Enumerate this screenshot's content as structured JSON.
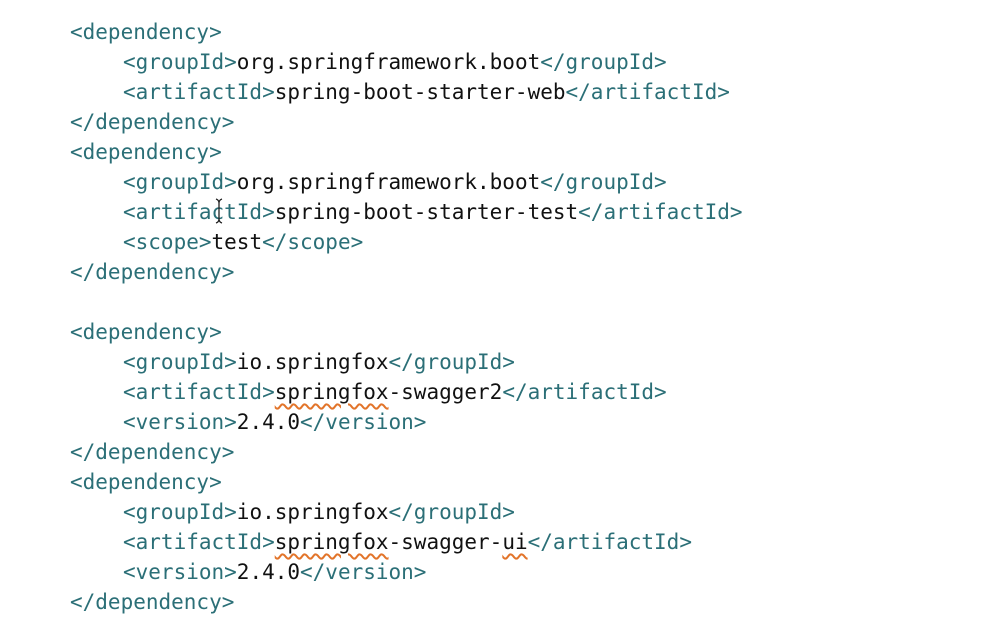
{
  "colors": {
    "tag": "#2b6f77",
    "text": "#111111",
    "spellcheck": "#e2742a",
    "background": "#ffffff"
  },
  "cursor": {
    "icon": "i-beam-cursor-icon"
  },
  "code_lines": [
    {
      "indent": 0,
      "parts": [
        {
          "t": "tag",
          "s": "<dependency>"
        }
      ]
    },
    {
      "indent": 1,
      "parts": [
        {
          "t": "tag",
          "s": "<groupId>"
        },
        {
          "t": "val",
          "s": "org.springframework.boot"
        },
        {
          "t": "tag",
          "s": "</groupId>"
        }
      ]
    },
    {
      "indent": 1,
      "parts": [
        {
          "t": "tag",
          "s": "<artifactId>"
        },
        {
          "t": "val",
          "s": "spring-boot-starter-web"
        },
        {
          "t": "tag",
          "s": "</artifactId>"
        }
      ]
    },
    {
      "indent": 0,
      "parts": [
        {
          "t": "tag",
          "s": "</dependency>"
        }
      ]
    },
    {
      "indent": 0,
      "parts": [
        {
          "t": "tag",
          "s": "<dependency>"
        }
      ]
    },
    {
      "indent": 1,
      "parts": [
        {
          "t": "tag",
          "s": "<groupId>"
        },
        {
          "t": "val",
          "s": "org.springframework.boot"
        },
        {
          "t": "tag",
          "s": "</groupId>"
        }
      ]
    },
    {
      "indent": 1,
      "parts": [
        {
          "t": "tag",
          "s": "<artifactId>"
        },
        {
          "t": "val",
          "s": "spring-boot-starter-test"
        },
        {
          "t": "tag",
          "s": "</artifactId>"
        }
      ]
    },
    {
      "indent": 1,
      "parts": [
        {
          "t": "tag",
          "s": "<scope>"
        },
        {
          "t": "val",
          "s": "test"
        },
        {
          "t": "tag",
          "s": "</scope>"
        }
      ]
    },
    {
      "indent": 0,
      "parts": [
        {
          "t": "tag",
          "s": "</dependency>"
        }
      ]
    },
    {
      "indent": 0,
      "parts": []
    },
    {
      "indent": 0,
      "parts": [
        {
          "t": "tag",
          "s": "<dependency>"
        }
      ]
    },
    {
      "indent": 1,
      "parts": [
        {
          "t": "tag",
          "s": "<groupId>"
        },
        {
          "t": "val",
          "s": "io.springfox"
        },
        {
          "t": "tag",
          "s": "</groupId>"
        }
      ]
    },
    {
      "indent": 1,
      "parts": [
        {
          "t": "tag",
          "s": "<artifactId>"
        },
        {
          "t": "val",
          "s": "springfox",
          "squiggle": true
        },
        {
          "t": "val",
          "s": "-swagger2"
        },
        {
          "t": "tag",
          "s": "</artifactId>"
        }
      ]
    },
    {
      "indent": 1,
      "parts": [
        {
          "t": "tag",
          "s": "<version>"
        },
        {
          "t": "val",
          "s": "2.4.0"
        },
        {
          "t": "tag",
          "s": "</version>"
        }
      ]
    },
    {
      "indent": 0,
      "parts": [
        {
          "t": "tag",
          "s": "</dependency>"
        }
      ]
    },
    {
      "indent": 0,
      "parts": [
        {
          "t": "tag",
          "s": "<dependency>"
        }
      ]
    },
    {
      "indent": 1,
      "parts": [
        {
          "t": "tag",
          "s": "<groupId>"
        },
        {
          "t": "val",
          "s": "io.springfox"
        },
        {
          "t": "tag",
          "s": "</groupId>"
        }
      ]
    },
    {
      "indent": 1,
      "parts": [
        {
          "t": "tag",
          "s": "<artifactId>"
        },
        {
          "t": "val",
          "s": "springfox",
          "squiggle": true
        },
        {
          "t": "val",
          "s": "-swagger-"
        },
        {
          "t": "val",
          "s": "ui",
          "squiggle": true
        },
        {
          "t": "tag",
          "s": "</artifactId>"
        }
      ]
    },
    {
      "indent": 1,
      "parts": [
        {
          "t": "tag",
          "s": "<version>"
        },
        {
          "t": "val",
          "s": "2.4.0"
        },
        {
          "t": "tag",
          "s": "</version>"
        }
      ]
    },
    {
      "indent": 0,
      "parts": [
        {
          "t": "tag",
          "s": "</dependency>"
        }
      ]
    }
  ]
}
